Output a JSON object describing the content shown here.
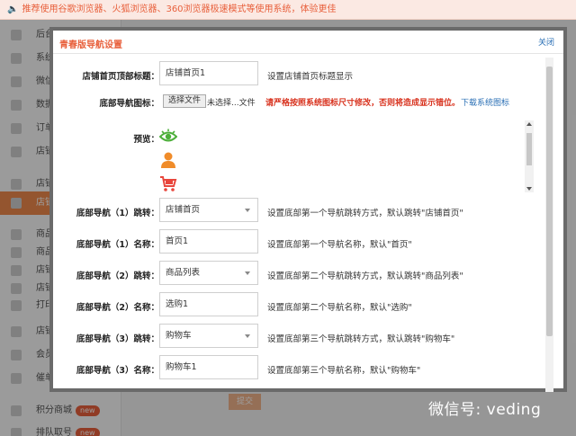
{
  "topbar": {
    "notice": "推荐使用谷歌浏览器、火狐浏览器、360浏览器极速模式等使用系统，体验更佳"
  },
  "bg_sidebar": {
    "items": [
      {
        "label": "后台"
      },
      {
        "label": "系统"
      },
      {
        "label": "微信"
      },
      {
        "label": "数据"
      },
      {
        "label": "订单"
      },
      {
        "label": "店铺"
      },
      {
        "label": "店铺"
      },
      {
        "label": "店铺"
      },
      {
        "label": "商品"
      },
      {
        "label": "商品"
      },
      {
        "label": "店铺"
      },
      {
        "label": "店铺"
      },
      {
        "label": "打印"
      },
      {
        "label": "店铺"
      },
      {
        "label": "会员"
      },
      {
        "label": "催单"
      },
      {
        "label": "积分商城",
        "badge": "new"
      },
      {
        "label": "排队取号",
        "badge": "new"
      }
    ],
    "active_index": 7
  },
  "bg_button": {
    "label": "提交"
  },
  "watermark": "微信号: veding",
  "dialog": {
    "title": "青春版导航设置",
    "close_label": "关闭",
    "header_title_field": {
      "label": "店铺首页顶部标题：",
      "value": "店铺首页1",
      "hint": "设置店铺首页标题显示"
    },
    "icon_field": {
      "label": "底部导航图标：",
      "file_button": "选择文件",
      "file_status": "未选择...文件",
      "warning": "请严格按照系统图标尺寸修改，否则将造成显示错位。",
      "download_link": "下载系统图标"
    },
    "preview": {
      "label": "预览：",
      "icons": [
        "eye-icon",
        "person-icon",
        "cart-icon"
      ]
    },
    "nav_rows": [
      {
        "label": "底部导航（1）跳转：",
        "type": "select",
        "value": "店铺首页",
        "hint": "设置底部第一个导航跳转方式，默认跳转\"店铺首页\""
      },
      {
        "label": "底部导航（1）名称：",
        "type": "input",
        "value": "首页1",
        "hint": "设置底部第一个导航名称，默认\"首页\""
      },
      {
        "label": "底部导航（2）跳转：",
        "type": "select",
        "value": "商品列表",
        "hint": "设置底部第二个导航跳转方式，默认跳转\"商品列表\""
      },
      {
        "label": "底部导航（2）名称：",
        "type": "input",
        "value": "选购1",
        "hint": "设置底部第二个导航名称，默认\"选购\""
      },
      {
        "label": "底部导航（3）跳转：",
        "type": "select",
        "value": "购物车",
        "hint": "设置底部第三个导航跳转方式，默认跳转\"购物车\""
      },
      {
        "label": "底部导航（3）名称：",
        "type": "input",
        "value": "购物车1",
        "hint": "设置底部第三个导航名称，默认\"购物车\""
      }
    ]
  },
  "colors": {
    "accent": "#e8603c",
    "link": "#2a6fb5",
    "warning": "#d8321e",
    "icon_green": "#4caf3a",
    "icon_orange": "#f08c2a",
    "icon_red": "#e8463c"
  }
}
